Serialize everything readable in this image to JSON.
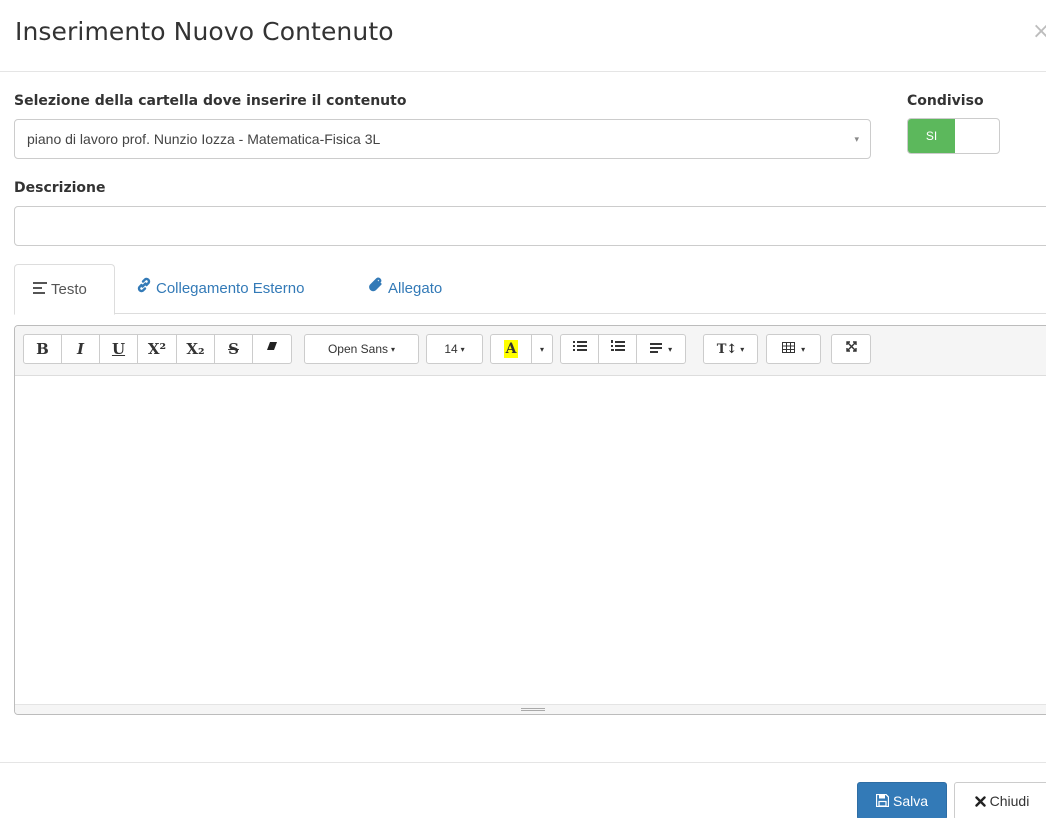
{
  "modal": {
    "title": "Inserimento Nuovo Contenuto",
    "close_symbol": "×"
  },
  "folder": {
    "label": "Selezione della cartella dove inserire il contenuto",
    "selected_value": "piano di lavoro prof. Nunzio Iozza - Matematica-Fisica 3L"
  },
  "shared": {
    "label": "Condiviso",
    "toggle_on_text": "SI"
  },
  "description": {
    "label": "Descrizione",
    "value": ""
  },
  "tabs": [
    {
      "label": "Testo",
      "icon": "align-left-icon",
      "active": true
    },
    {
      "label": "Collegamento Esterno",
      "icon": "link-icon",
      "active": false
    },
    {
      "label": "Allegato",
      "icon": "paperclip-icon",
      "active": false
    }
  ],
  "editor": {
    "font_family_label": "Open Sans",
    "font_size_label": "14",
    "highlight_color": "#ffff00",
    "buttons": {
      "bold": "B",
      "italic": "I",
      "underline": "U",
      "superscript": "X²",
      "subscript": "X₂",
      "strikethrough": "S",
      "caret": "▾"
    },
    "content": ""
  },
  "footer": {
    "save_label": "Salva",
    "close_label": "Chiudi"
  },
  "colors": {
    "primary": "#337ab7",
    "success": "#5cb85c",
    "link": "#337ab7"
  }
}
